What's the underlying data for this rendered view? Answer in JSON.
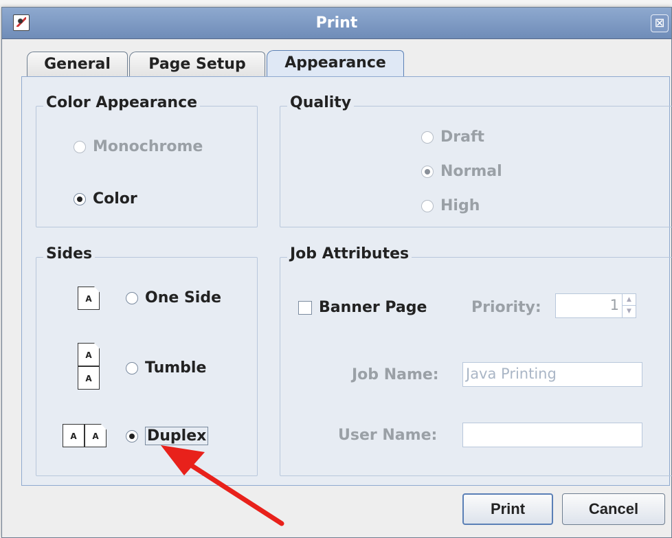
{
  "window": {
    "title": "Print",
    "close_glyph": "⊠"
  },
  "tabs": [
    {
      "label": "General",
      "selected": false
    },
    {
      "label": "Page Setup",
      "selected": false
    },
    {
      "label": "Appearance",
      "selected": true
    }
  ],
  "color_appearance": {
    "title": "Color Appearance",
    "options": [
      {
        "label": "Monochrome",
        "checked": false,
        "enabled": false
      },
      {
        "label": "Color",
        "checked": true,
        "enabled": true
      }
    ]
  },
  "quality": {
    "title": "Quality",
    "options": [
      {
        "label": "Draft",
        "checked": false,
        "enabled": false
      },
      {
        "label": "Normal",
        "checked": true,
        "enabled": false
      },
      {
        "label": "High",
        "checked": false,
        "enabled": false
      }
    ]
  },
  "sides": {
    "title": "Sides",
    "icon_letter": "A",
    "options": [
      {
        "label": "One Side",
        "checked": false
      },
      {
        "label": "Tumble",
        "checked": false
      },
      {
        "label": "Duplex",
        "checked": true
      }
    ]
  },
  "job_attributes": {
    "title": "Job Attributes",
    "banner_page_label": "Banner Page",
    "banner_page_checked": false,
    "priority_label": "Priority:",
    "priority_value": "1",
    "job_name_label": "Job Name:",
    "job_name_value": "Java Printing",
    "user_name_label": "User Name:",
    "user_name_value": ""
  },
  "buttons": {
    "print": "Print",
    "cancel": "Cancel"
  },
  "annotation": {
    "arrow_color": "#e8211b"
  }
}
